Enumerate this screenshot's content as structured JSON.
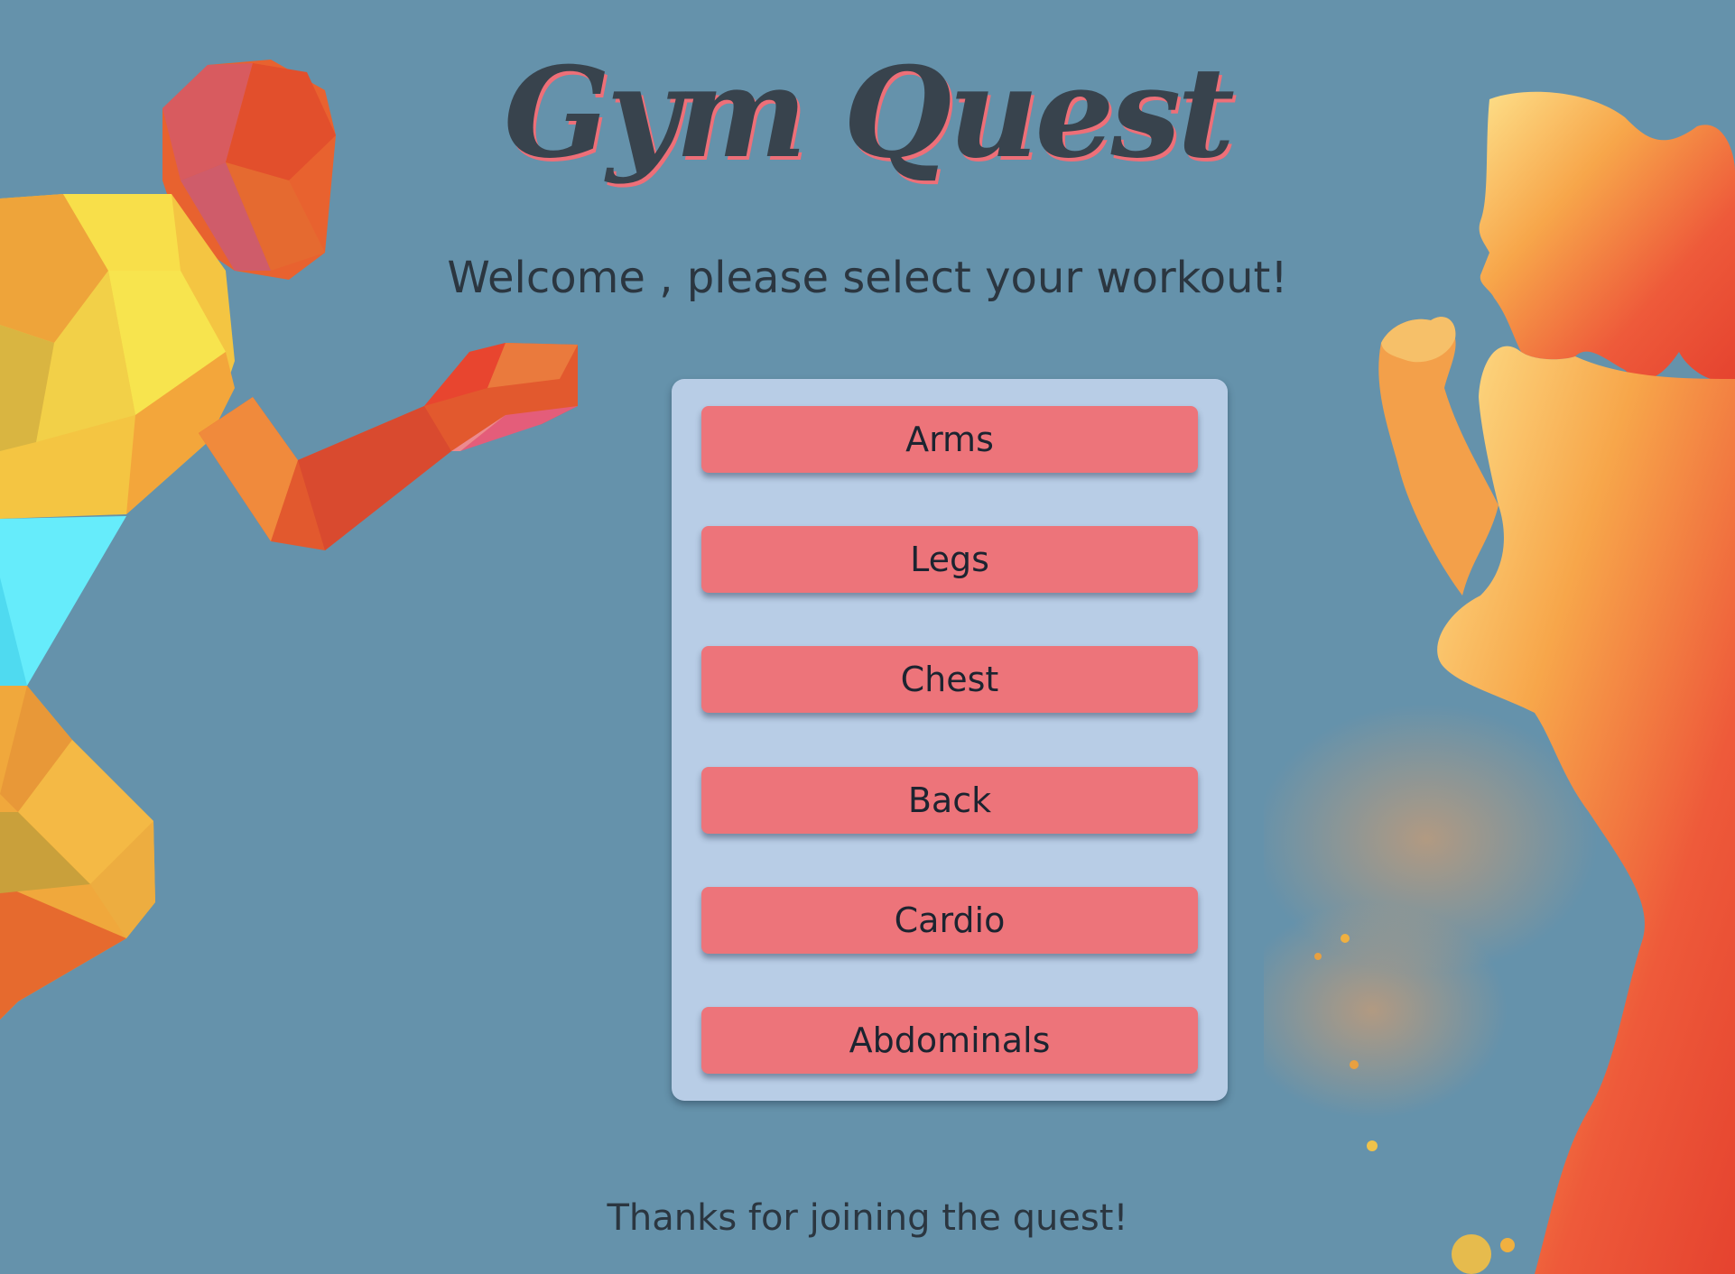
{
  "app": {
    "title": "Gym Quest",
    "welcome": "Welcome , please select your workout!",
    "footer": "Thanks for joining the quest!"
  },
  "workouts": [
    {
      "label": "Arms"
    },
    {
      "label": "Legs"
    },
    {
      "label": "Chest"
    },
    {
      "label": "Back"
    },
    {
      "label": "Cardio"
    },
    {
      "label": "Abdominals"
    }
  ],
  "colors": {
    "background": "#6592ab",
    "panel": "#b8cde6",
    "button": "#ed747a",
    "title_text": "#38434d",
    "title_shadow": "#ee6f78"
  }
}
